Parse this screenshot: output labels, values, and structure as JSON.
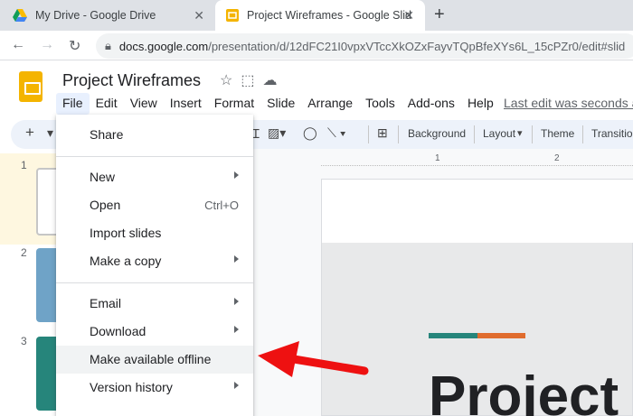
{
  "browser": {
    "tabs": [
      {
        "title": "My Drive - Google Drive",
        "icon": "google-drive-icon"
      },
      {
        "title": "Project Wireframes - Google Slid",
        "icon": "google-slides-icon"
      }
    ],
    "url_host": "docs.google.com",
    "url_path": "/presentation/d/12dFC21I0vpxVTccXkOZxFayvTQpBfeXYs6L_15cPZr0/edit#slid"
  },
  "slides": {
    "doc_title": "Project Wireframes",
    "menu": [
      "File",
      "Edit",
      "View",
      "Insert",
      "Format",
      "Slide",
      "Arrange",
      "Tools",
      "Add-ons",
      "Help"
    ],
    "last_edit": "Last edit was seconds ago",
    "toolbar": {
      "background": "Background",
      "layout": "Layout",
      "theme": "Theme",
      "transition": "Transition"
    },
    "ruler_marks": [
      "1",
      "2"
    ],
    "slide_numbers": [
      "1",
      "2",
      "3"
    ],
    "canvas_title": "Project"
  },
  "file_menu": {
    "items": [
      {
        "label": "Share",
        "shortcut": "",
        "submenu": false
      },
      {
        "label": "New",
        "shortcut": "",
        "submenu": true
      },
      {
        "label": "Open",
        "shortcut": "Ctrl+O",
        "submenu": false
      },
      {
        "label": "Import slides",
        "shortcut": "",
        "submenu": false
      },
      {
        "label": "Make a copy",
        "shortcut": "",
        "submenu": true
      },
      {
        "label": "Email",
        "shortcut": "",
        "submenu": true
      },
      {
        "label": "Download",
        "shortcut": "",
        "submenu": true
      },
      {
        "label": "Make available offline",
        "shortcut": "",
        "submenu": false,
        "highlighted": true
      },
      {
        "label": "Version history",
        "shortcut": "",
        "submenu": true
      }
    ]
  },
  "colors": {
    "accent_teal": "#26857b",
    "accent_orange": "#e06c2e",
    "arrow_red": "#ee1111",
    "brand_yellow": "#f4b400"
  }
}
